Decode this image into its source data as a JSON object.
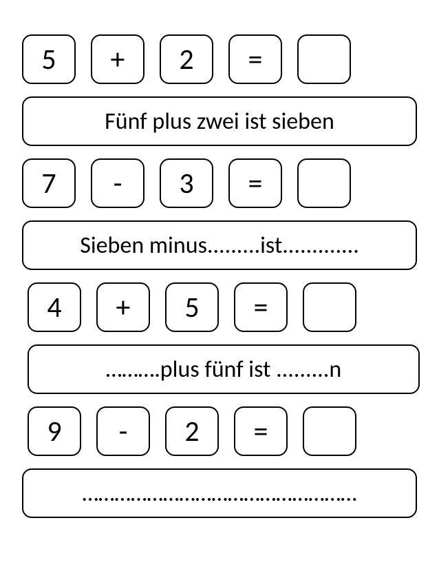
{
  "exercises": [
    {
      "cells": [
        "5",
        "+",
        "2",
        "=",
        ""
      ],
      "sentence": "Fünf plus zwei ist sieben"
    },
    {
      "cells": [
        "7",
        "-",
        "3",
        "=",
        ""
      ],
      "sentence": "Sieben minus.........ist............."
    },
    {
      "cells": [
        "4",
        "+",
        "5",
        "=",
        ""
      ],
      "sentence": "……….plus fünf ist .........n"
    },
    {
      "cells": [
        "9",
        "-",
        "2",
        "=",
        ""
      ],
      "sentence": "……………………………………………"
    }
  ]
}
